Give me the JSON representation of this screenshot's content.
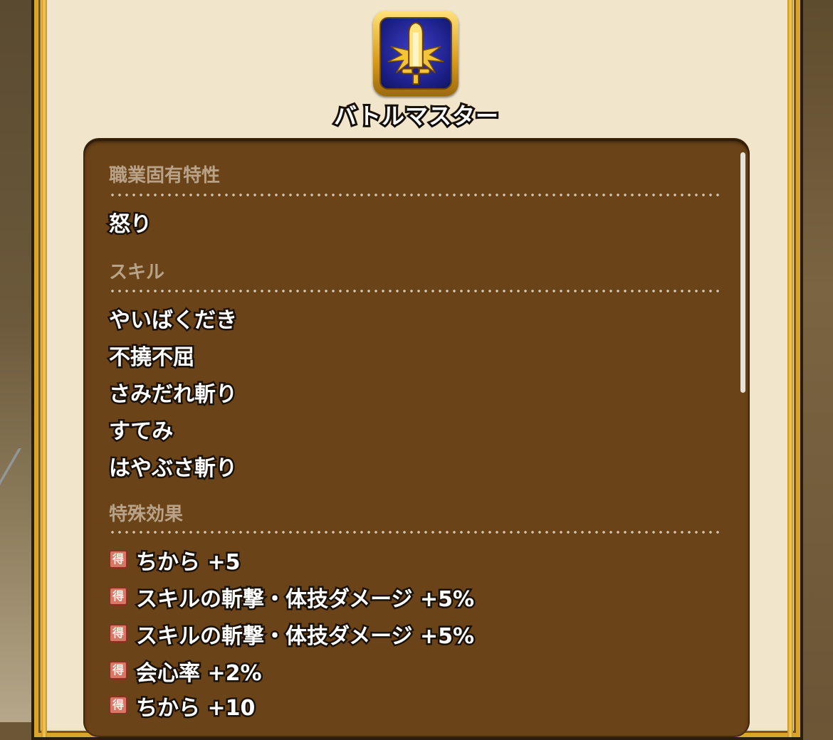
{
  "job": {
    "name": "バトルマスター",
    "emblem_icon": "sword-emblem-icon"
  },
  "sections": {
    "trait": {
      "heading": "職業固有特性",
      "items": [
        "怒り"
      ]
    },
    "skills": {
      "heading": "スキル",
      "items": [
        "やいばくだき",
        "不撓不屈",
        "さみだれ斬り",
        "すてみ",
        "はやぶさ斬り"
      ]
    },
    "effects": {
      "heading": "特殊効果",
      "badge": "得",
      "items": [
        "ちから +5",
        "スキルの斬撃・体技ダメージ +5%",
        "スキルの斬撃・体技ダメージ +5%",
        "会心率 +2%",
        "ちから +10"
      ]
    }
  },
  "colors": {
    "panel": "#f1e6cc",
    "detail_box": "#6a4318",
    "heading": "#b8a288",
    "gold_trim": "#d9a52b",
    "emblem_blue": "#1c1f86"
  }
}
